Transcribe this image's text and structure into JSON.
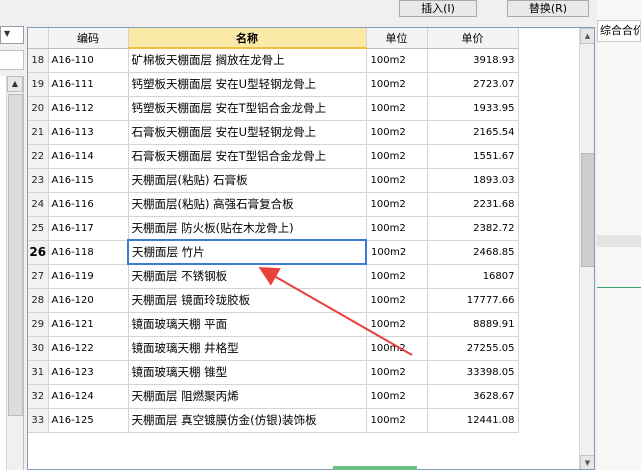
{
  "toolbar": {
    "insert_label": "插入(I)",
    "replace_label": "替换(R)"
  },
  "left": {
    "dropdown_arrow": "▼",
    "scroll_up": "▲"
  },
  "right_panel": {
    "header": "综合合价"
  },
  "grid": {
    "columns": [
      "编码",
      "名称",
      "单位",
      "单价"
    ],
    "rows": [
      {
        "num": "18",
        "code": "A16-110",
        "name": "矿棉板天棚面层 搁放在龙骨上",
        "unit": "100m2",
        "price": "3918.93"
      },
      {
        "num": "19",
        "code": "A16-111",
        "name": "钙塑板天棚面层 安在U型轻钢龙骨上",
        "unit": "100m2",
        "price": "2723.07"
      },
      {
        "num": "20",
        "code": "A16-112",
        "name": "钙塑板天棚面层 安在T型铝合金龙骨上",
        "unit": "100m2",
        "price": "1933.95"
      },
      {
        "num": "21",
        "code": "A16-113",
        "name": "石膏板天棚面层 安在U型轻钢龙骨上",
        "unit": "100m2",
        "price": "2165.54"
      },
      {
        "num": "22",
        "code": "A16-114",
        "name": "石膏板天棚面层 安在T型铝合金龙骨上",
        "unit": "100m2",
        "price": "1551.67"
      },
      {
        "num": "23",
        "code": "A16-115",
        "name": "天棚面层(粘贴) 石膏板",
        "unit": "100m2",
        "price": "1893.03"
      },
      {
        "num": "24",
        "code": "A16-116",
        "name": "天棚面层(粘贴) 高强石膏复合板",
        "unit": "100m2",
        "price": "2231.68"
      },
      {
        "num": "25",
        "code": "A16-117",
        "name": "天棚面层 防火板(贴在木龙骨上)",
        "unit": "100m2",
        "price": "2382.72"
      },
      {
        "num": "26",
        "code": "A16-118",
        "name": "天棚面层 竹片",
        "unit": "100m2",
        "price": "2468.85"
      },
      {
        "num": "27",
        "code": "A16-119",
        "name": "天棚面层 不锈钢板",
        "unit": "100m2",
        "price": "16807"
      },
      {
        "num": "28",
        "code": "A16-120",
        "name": "天棚面层 镜面玲珑胶板",
        "unit": "100m2",
        "price": "17777.66"
      },
      {
        "num": "29",
        "code": "A16-121",
        "name": "镜面玻璃天棚 平面",
        "unit": "100m2",
        "price": "8889.91"
      },
      {
        "num": "30",
        "code": "A16-122",
        "name": "镜面玻璃天棚 井格型",
        "unit": "100m2",
        "price": "27255.05"
      },
      {
        "num": "31",
        "code": "A16-123",
        "name": "镜面玻璃天棚 锥型",
        "unit": "100m2",
        "price": "33398.05"
      },
      {
        "num": "32",
        "code": "A16-124",
        "name": "天棚面层 阻燃聚丙烯",
        "unit": "100m2",
        "price": "3628.67"
      },
      {
        "num": "33",
        "code": "A16-125",
        "name": "天棚面层 真空镀膜仿金(仿银)装饰板",
        "unit": "100m2",
        "price": "12441.08"
      }
    ],
    "selected_row": "26"
  },
  "colors": {
    "selection_border": "#3c7bd6",
    "header_highlight": "#fbe9a8",
    "arrow": "#e8413c"
  }
}
